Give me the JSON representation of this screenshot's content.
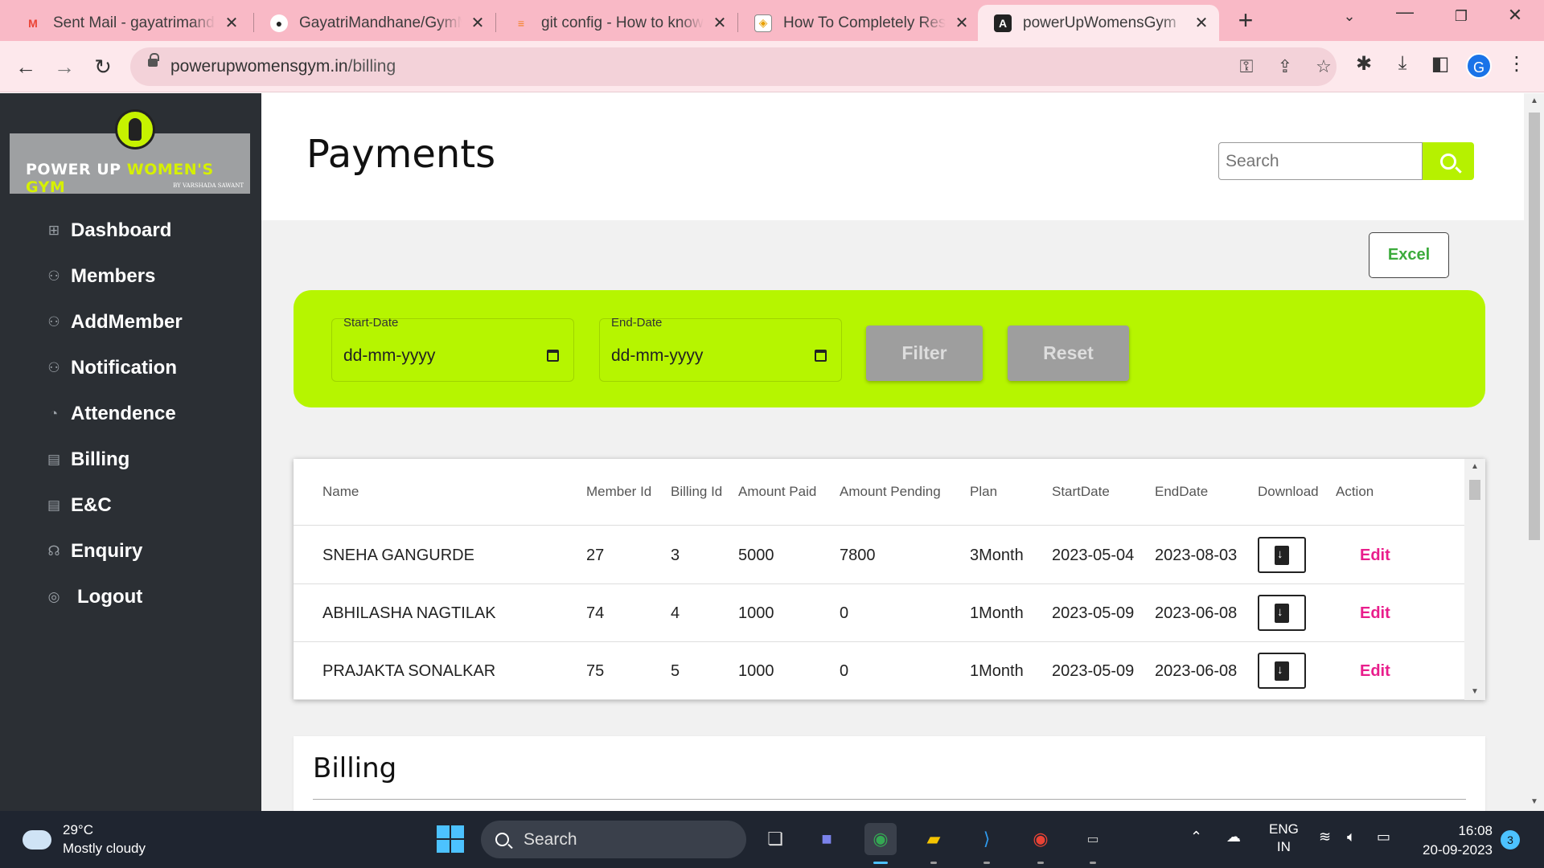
{
  "browser": {
    "tabs": [
      {
        "title": "Sent Mail - gayatrimandhane",
        "icon": "gmail-icon"
      },
      {
        "title": "GayatriMandhane/GymManagement",
        "icon": "github-icon"
      },
      {
        "title": "git config - How to know the git username",
        "icon": "stackoverflow-icon"
      },
      {
        "title": "How To Completely Reset",
        "icon": "site-icon"
      },
      {
        "title": "powerUpWomensGym",
        "icon": "angular-icon"
      }
    ],
    "url_domain": "powerupwomensgym.in",
    "url_path": "/billing",
    "profile_initial": "G"
  },
  "sidebar": {
    "logo": {
      "brand_white": "POWER UP ",
      "brand_yellow": "WOMEN'S GYM",
      "byline": "BY VARSHADA SAWANT"
    },
    "items": [
      {
        "label": "Dashboard",
        "icon": "grid-icon"
      },
      {
        "label": "Members",
        "icon": "users-icon"
      },
      {
        "label": "AddMember",
        "icon": "users-icon"
      },
      {
        "label": "Notification",
        "icon": "users-icon"
      },
      {
        "label": "Attendence",
        "icon": "pie-icon"
      },
      {
        "label": "Billing",
        "icon": "receipt-icon"
      },
      {
        "label": "E&C",
        "icon": "receipt-icon"
      },
      {
        "label": "Enquiry",
        "icon": "headset-icon"
      },
      {
        "label": "Logout",
        "icon": "user-circle-icon"
      }
    ]
  },
  "header": {
    "title": "Payments",
    "search_placeholder": "Search"
  },
  "excel_label": "Excel",
  "filter": {
    "start_label": "Start-Date",
    "start_value": "dd-mm-yyyy",
    "end_label": "End-Date",
    "end_value": "dd-mm-yyyy",
    "filter_label": "Filter",
    "reset_label": "Reset"
  },
  "table": {
    "columns": [
      "Name",
      "Member Id",
      "Billing Id",
      "Amount Paid",
      "Amount Pending",
      "Plan",
      "StartDate",
      "EndDate",
      "Download",
      "Action"
    ],
    "rows": [
      {
        "name": "SNEHA GANGURDE",
        "member_id": "27",
        "billing_id": "3",
        "amount_paid": "5000",
        "amount_pending": "7800",
        "plan": "3Month",
        "start": "2023-05-04",
        "end": "2023-08-03",
        "action": "Edit"
      },
      {
        "name": "ABHILASHA NAGTILAK",
        "member_id": "74",
        "billing_id": "4",
        "amount_paid": "1000",
        "amount_pending": "0",
        "plan": "1Month",
        "start": "2023-05-09",
        "end": "2023-06-08",
        "action": "Edit"
      },
      {
        "name": "PRAJAKTA SONALKAR",
        "member_id": "75",
        "billing_id": "5",
        "amount_paid": "1000",
        "amount_pending": "0",
        "plan": "1Month",
        "start": "2023-05-09",
        "end": "2023-06-08",
        "action": "Edit"
      }
    ]
  },
  "billing_section": {
    "title": "Billing"
  },
  "taskbar": {
    "weather_temp": "29°C",
    "weather_desc": "Mostly cloudy",
    "search_label": "Search",
    "lang_1": "ENG",
    "lang_2": "IN",
    "time": "16:08",
    "date": "20-09-2023",
    "notifications": "3"
  },
  "colors": {
    "accent": "#b6f500",
    "sidebar": "#2b2f34",
    "edit": "#e91e8c",
    "excel": "#3cab3c",
    "tabstrip": "#f9b9c6"
  }
}
